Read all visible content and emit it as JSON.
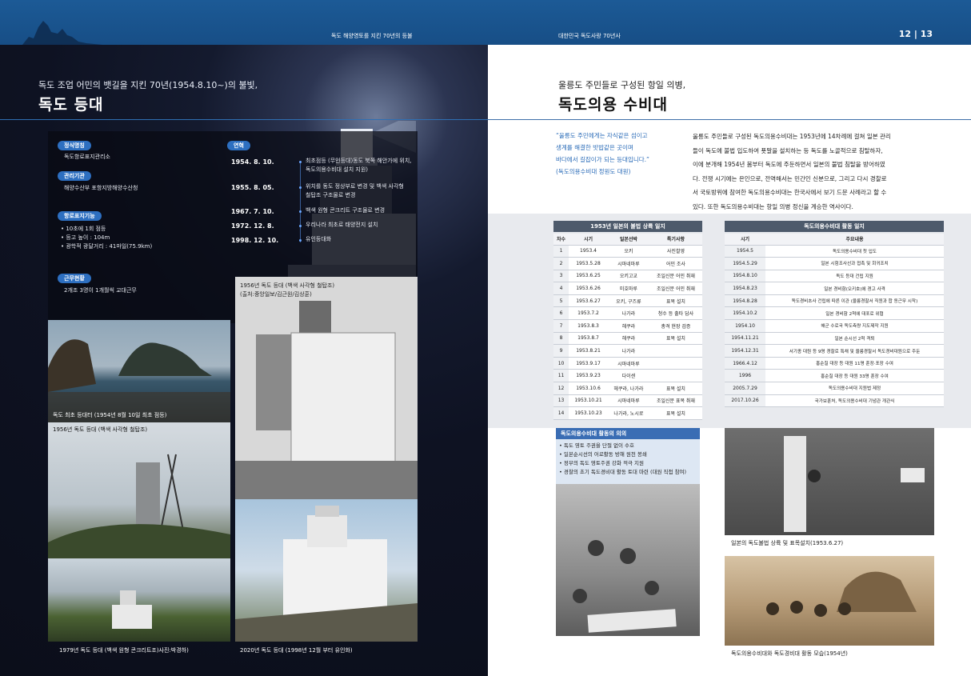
{
  "header": {
    "left_section": "독도 해양영토를 지킨 70년의 등불",
    "right_section": "대한민국 독도사랑 70년사",
    "page_numbers": "12 | 13"
  },
  "left_page": {
    "subtitle": "독도 조업 어민의 뱃길을 지킨 70년(1954.8.10~)의 불빛,",
    "title": "독도 등대",
    "info": {
      "official_name_label": "정식명칭",
      "official_name": "독도항로표지관리소",
      "agency_label": "관리기관",
      "agency": "해양수산부 포항지방해양수산청",
      "function_label": "항로표지기능",
      "functions": "• 10초에 1회 점등\n• 등고 높이 : 104m\n• 광학적 광달거리 : 41마일(75.9km)",
      "duty_label": "근무현황",
      "duty": "2개조 3명이 1개월씩 교대근무"
    },
    "history_label": "연혁",
    "history": [
      {
        "date": "1954. 8. 10.",
        "event": "최초점등 (무인등대)동도 북쪽 해안가에 위치,\n독도의용수비대 설치 지원)"
      },
      {
        "date": "1955. 8. 05.",
        "event": "위치를 동도 정상부로 변경 및 백색 사각형\n철탑조 구조물로 변경"
      },
      {
        "date": "1967. 7. 10.",
        "event": "백색 원형 콘크리트 구조물로 변경"
      },
      {
        "date": "1972. 12. 8.",
        "event": "우리나라 최초로 태양전지 설치"
      },
      {
        "date": "1998. 12. 10.",
        "event": "유인등대화"
      }
    ],
    "captions": {
      "photo1": "독도 최초 등대터 (1954년 8월 10일 최초 점등)",
      "photo2": "1956년 독도 등대 (백색 사각형 철탑조)\n(출처:중앙일보/김근원/김상훈)",
      "photo3": "1956년 독도 등대 (백색 사각형 철탑조)",
      "photo4": "1979년 독도 등대 (백색 원형 콘크리트조)사진:박경하)",
      "photo5": "2020년 독도 등대 (1998년 12월 부터 유인화)"
    }
  },
  "right_page": {
    "subtitle": "울릉도 주민들로 구성된 항일 의병,",
    "title": "독도의용 수비대",
    "quote": "“울릉도 주민에게는 자식같은 섬이고\n생계를 해결한 밧밥같은 곳이며\n바다에서 길잡이가 되는 등대입니다.”\n(독도의용수비대 정원도 대원)",
    "body": "울릉도 주민들로 구성된 독도의용수비대는 1953년에 14차례에 걸쳐 일본 관리\n들이 독도에 불법 입도하여 푯말을 설치하는 등 독도를 노골적으로 침탈하자,\n이에 분개해 1954년 봄부터 독도에 주둔하면서 일본의 불법 침탈을 방어하였\n다. 전쟁 시기에는 은인으로, 전역해서는 민간인 신분으로, 그리고 다시 경찰로\n서 국토방위에 참여한 독도의용수비대는 한국사에서 보기 드문 사례라고 할 수\n있다. 또한 독도의용수비대는 항일 의병 정신을 계승한 역사이다.",
    "table1": {
      "title": "1953년 일본의 불법 상륙 일지",
      "headers": [
        "차수",
        "시기",
        "일본선박",
        "특기사항"
      ],
      "rows": [
        [
          "1",
          "1953.4",
          "오키",
          "사진촬영"
        ],
        [
          "2",
          "1953.5.28",
          "시마네마루",
          "어민 조사"
        ],
        [
          "3",
          "1953.6.25",
          "오키고교",
          "조일신문 어민 취재"
        ],
        [
          "4",
          "1953.6.26",
          "미호마루",
          "조일신문 어민 취재"
        ],
        [
          "5",
          "1953.6.27",
          "오키, 구즈류",
          "표목 설치"
        ],
        [
          "6",
          "1953.7.2",
          "나가라",
          "청수 등 출타 답사"
        ],
        [
          "7",
          "1953.8.3",
          "헤쿠라",
          "총격 현장 검증"
        ],
        [
          "8",
          "1953.8.7",
          "헤쿠라",
          "표목 설치"
        ],
        [
          "9",
          "1953.8.21",
          "나가라",
          ""
        ],
        [
          "10",
          "1953.9.17",
          "시마네마루",
          ""
        ],
        [
          "11",
          "1953.9.23",
          "다이센",
          ""
        ],
        [
          "12",
          "1953.10.6",
          "헤쿠라, 나가라",
          "표목 설치"
        ],
        [
          "13",
          "1953.10.21",
          "시마네마루",
          "조일신문 표목 취재"
        ],
        [
          "14",
          "1953.10.23",
          "나가라, 노시로",
          "표목 설치"
        ]
      ]
    },
    "table2": {
      "title": "독도의용수비대 활동 일지",
      "headers": [
        "시기",
        "주요내용"
      ],
      "rows": [
        [
          "1954.5",
          "독도의용수비대 첫 입도"
        ],
        [
          "1954.5.29",
          "일본 시험조사선과 접촉 및 회귀조치"
        ],
        [
          "1954.8.10",
          "독도 등대 건립 지원"
        ],
        [
          "1954.8.23",
          "일본 경비함(오키호)에 경고 사격"
        ],
        [
          "1954.8.28",
          "독도경비초사 건립에 따른 이관 (울릉경찰서 직원과 합 동근무 시작)"
        ],
        [
          "1954.10.2",
          "일본 경비함 2척에 대포로 위협"
        ],
        [
          "1954.10",
          "해군 수로국 독도측량 지도제작 지원"
        ],
        [
          "1954.11.21",
          "일본 순시선 2척 격퇴"
        ],
        [
          "1954.12.31",
          "서기종 대원 등 9명 경찰로 특채 및 울릉경찰서 독도경비대원으로 주둔"
        ],
        [
          "1966.4.12",
          "홍순칠 대장 등 대원 11명 훈장·포장 수여"
        ],
        [
          "1996",
          "홍순칠 대장 등 대원 33명 훈장 수여"
        ],
        [
          "2005.7.29",
          "독도의용수비대 지원법 제정"
        ],
        [
          "2017.10.26",
          "국가보훈처, 독도의용수비대 기념관 개관식"
        ]
      ]
    },
    "meaning": {
      "title": "독도의용수비대 활동의 의의",
      "items": [
        "• 독도 영토 주권을 단절 없이 수호",
        "• 일본순시선의 어로활동 방해 원천 봉쇄",
        "• 정부의 독도 영토주권 강화 적극 지원",
        "• 경찰의 초기 독도경비대 활동 토대 마련 (대원 직접 참여)"
      ]
    },
    "captions": {
      "photo_right1": "일본의 독도불법 상륙 및 표목설치(1953.6.27)",
      "photo_right2": "독도의용수비대와 독도경비대 활동 모습(1954년)"
    }
  }
}
